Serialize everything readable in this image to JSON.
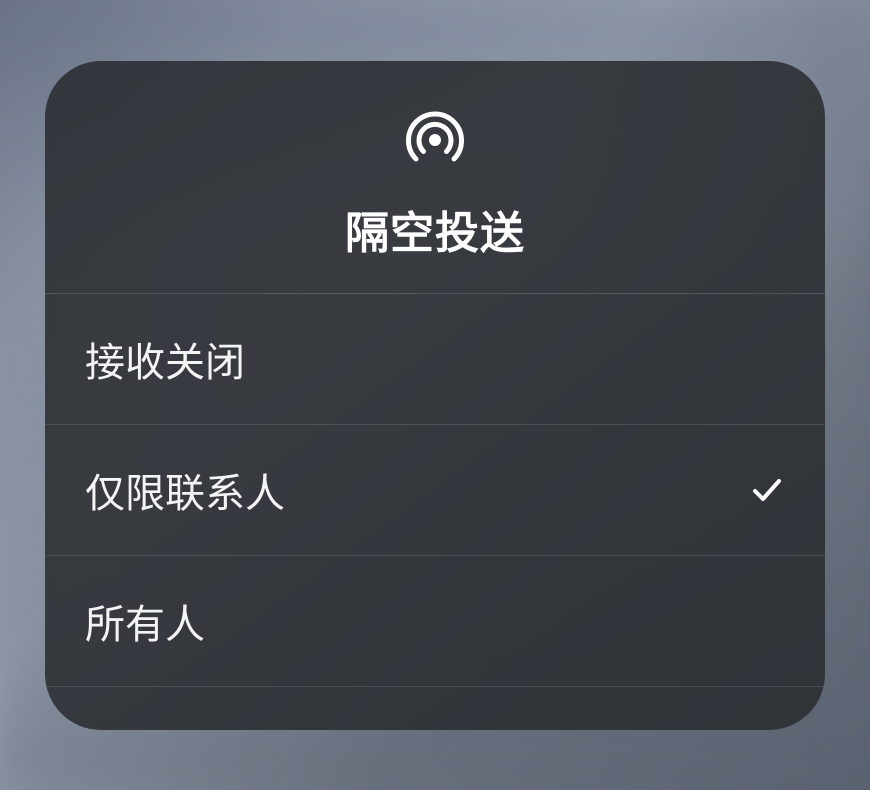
{
  "header": {
    "title": "隔空投送",
    "icon": "airdrop-icon"
  },
  "options": [
    {
      "id": "receiving-off",
      "label": "接收关闭",
      "selected": false
    },
    {
      "id": "contacts-only",
      "label": "仅限联系人",
      "selected": true
    },
    {
      "id": "everyone",
      "label": "所有人",
      "selected": false
    }
  ]
}
